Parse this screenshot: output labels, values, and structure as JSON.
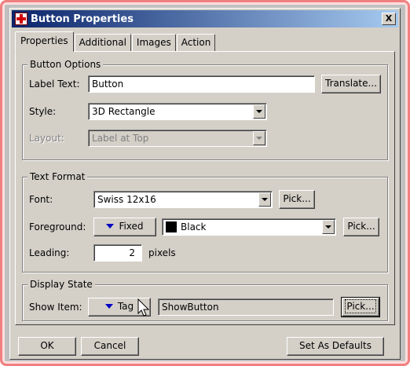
{
  "window": {
    "title": "Button Properties",
    "close_symbol": "X"
  },
  "tabs": [
    {
      "label": "Properties",
      "active": true
    },
    {
      "label": "Additional",
      "active": false
    },
    {
      "label": "Images",
      "active": false
    },
    {
      "label": "Action",
      "active": false
    }
  ],
  "button_options": {
    "legend": "Button Options",
    "label_text_label": "Label Text:",
    "label_text_value": "Button",
    "translate_button": "Translate...",
    "style_label": "Style:",
    "style_value": "3D Rectangle",
    "layout_label": "Layout:",
    "layout_value": "Label at Top"
  },
  "text_format": {
    "legend": "Text Format",
    "font_label": "Font:",
    "font_value": "Swiss 12x16",
    "font_pick_button": "Pick...",
    "foreground_label": "Foreground:",
    "foreground_mode_button": "Fixed",
    "foreground_color": "Black",
    "foreground_swatch": "#000000",
    "foreground_pick_button": "Pick...",
    "leading_label": "Leading:",
    "leading_value": "2",
    "leading_unit": "pixels"
  },
  "display_state": {
    "legend": "Display State",
    "show_item_label": "Show Item:",
    "show_item_mode_button": "Tag",
    "show_item_tag": "ShowButton",
    "show_item_pick_button": "Pick..."
  },
  "footer": {
    "ok_button": "OK",
    "cancel_button": "Cancel",
    "defaults_button": "Set As Defaults"
  },
  "colors": {
    "titlebar_start": "#0a246a",
    "titlebar_end": "#a6caf0",
    "mode_arrow": "#0000c0",
    "face": "#d4d0c8"
  }
}
